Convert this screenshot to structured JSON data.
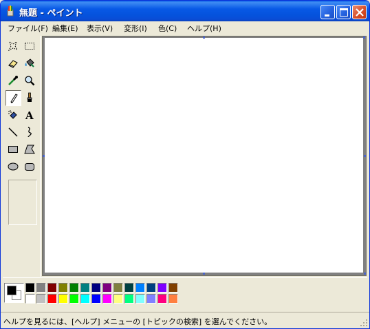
{
  "window": {
    "title": "無題 - ペイント",
    "title_color": "#ffffff",
    "titlebar_color": "#0553dd"
  },
  "menu": [
    {
      "label": "ファイル(F)"
    },
    {
      "label": "編集(E)"
    },
    {
      "label": "表示(V)"
    },
    {
      "label": "変形(I)"
    },
    {
      "label": "色(C)"
    },
    {
      "label": "ヘルプ(H)"
    }
  ],
  "tools": [
    {
      "name": "free-form-select",
      "icon": "free-select-icon",
      "selected": false
    },
    {
      "name": "rect-select",
      "icon": "rect-select-icon",
      "selected": false
    },
    {
      "name": "eraser",
      "icon": "eraser-icon",
      "selected": false
    },
    {
      "name": "fill",
      "icon": "paint-bucket-icon",
      "selected": false
    },
    {
      "name": "pick-color",
      "icon": "eyedropper-icon",
      "selected": false
    },
    {
      "name": "magnifier",
      "icon": "magnifier-icon",
      "selected": false
    },
    {
      "name": "pencil",
      "icon": "pencil-icon",
      "selected": true
    },
    {
      "name": "brush",
      "icon": "brush-icon",
      "selected": false
    },
    {
      "name": "airbrush",
      "icon": "airbrush-icon",
      "selected": false
    },
    {
      "name": "text",
      "icon": "text-icon",
      "selected": false
    },
    {
      "name": "line",
      "icon": "line-icon",
      "selected": false
    },
    {
      "name": "curve",
      "icon": "curve-icon",
      "selected": false
    },
    {
      "name": "rectangle",
      "icon": "rectangle-icon",
      "selected": false
    },
    {
      "name": "polygon",
      "icon": "polygon-icon",
      "selected": false
    },
    {
      "name": "ellipse",
      "icon": "ellipse-icon",
      "selected": false
    },
    {
      "name": "rounded-rectangle",
      "icon": "rounded-rect-icon",
      "selected": false
    }
  ],
  "text_tool_glyph": "A",
  "current_colors": {
    "foreground": "#000000",
    "background": "#ffffff"
  },
  "palette": {
    "row1": [
      "#000000",
      "#808080",
      "#800000",
      "#808000",
      "#008000",
      "#008080",
      "#000080",
      "#800080",
      "#808040",
      "#004040",
      "#0080ff",
      "#004080",
      "#8000ff",
      "#804000"
    ],
    "row2": [
      "#ffffff",
      "#c0c0c0",
      "#ff0000",
      "#ffff00",
      "#00ff00",
      "#00ffff",
      "#0000ff",
      "#ff00ff",
      "#ffff80",
      "#00ff80",
      "#80ffff",
      "#8080ff",
      "#ff0080",
      "#ff8040"
    ]
  },
  "status": {
    "text": "ヘルプを見るには、[ヘルプ] メニューの [トピックの検索] を選んでください。"
  }
}
